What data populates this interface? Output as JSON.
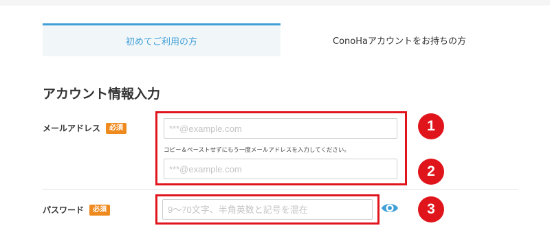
{
  "tabs": [
    {
      "label": "初めてご利用の方",
      "active": true
    },
    {
      "label": "ConoHaアカウントをお持ちの方",
      "active": false
    }
  ],
  "section_title": "アカウント情報入力",
  "email": {
    "label": "メールアドレス",
    "badge": "必須",
    "placeholder": "***@example.com",
    "confirm_hint": "コピー＆ペーストせずにもう一度メールアドレスを入力してください。",
    "confirm_placeholder": "***@example.com"
  },
  "password": {
    "label": "パスワード",
    "badge": "必須",
    "placeholder": "9～70文字、半角英数と記号を混在"
  },
  "markers": [
    "1",
    "2",
    "3"
  ],
  "colors": {
    "accent": "#3f9fd7",
    "badge": "#ef8a1e",
    "annotation_red": "#e0151c"
  },
  "icons": {
    "password_toggle": "eye-icon"
  }
}
